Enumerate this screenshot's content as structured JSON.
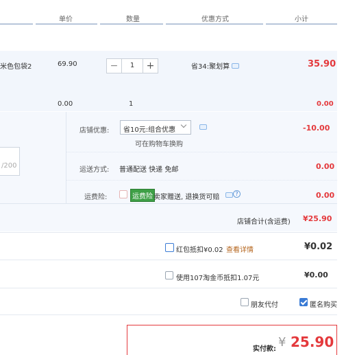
{
  "header": {
    "price": "单价",
    "qty": "数量",
    "discount": "优惠方式",
    "subtotal": "小计"
  },
  "item": {
    "name": "米色包袋2",
    "price": "69.90",
    "qty": "1",
    "discount": "省34:聚划算",
    "subtotal": "35.90"
  },
  "item2": {
    "price": "0.00",
    "qty": "1",
    "subtotal": "0.00"
  },
  "stepper": {
    "minus": "−",
    "plus": "+"
  },
  "shop": {
    "coupon_label": "店铺优惠:",
    "coupon_value": "省10元:组合优惠",
    "coupon_amount": "-10.00",
    "coupon_note": "可在购物车换购",
    "memo_counter": "/200",
    "delivery_label": "运送方式:",
    "delivery_value": "普通配送 快递 免邮",
    "delivery_amount": "0.00",
    "insurance_label": "运费险:",
    "insurance_tag": "运费险",
    "insurance_text": "卖家赠送, 退换货可赔",
    "insurance_amount": "0.00",
    "total_label": "店铺合计(含运费)",
    "total_value": "¥25.90"
  },
  "redpacket": {
    "label": "红包抵扣¥0.02",
    "link": "查看详情",
    "amount": "¥0.02"
  },
  "coins": {
    "label": "使用107淘金币抵扣1.07元",
    "amount": "¥0.00"
  },
  "options": {
    "friend_pay": "朋友代付",
    "anonymous": "匿名购买"
  },
  "payment": {
    "label": "实付款:",
    "currency": "¥",
    "amount": "25.90"
  },
  "colors": {
    "accent": "#e4393c",
    "band": "#f2f6fc",
    "link": "#3a7bd5"
  }
}
